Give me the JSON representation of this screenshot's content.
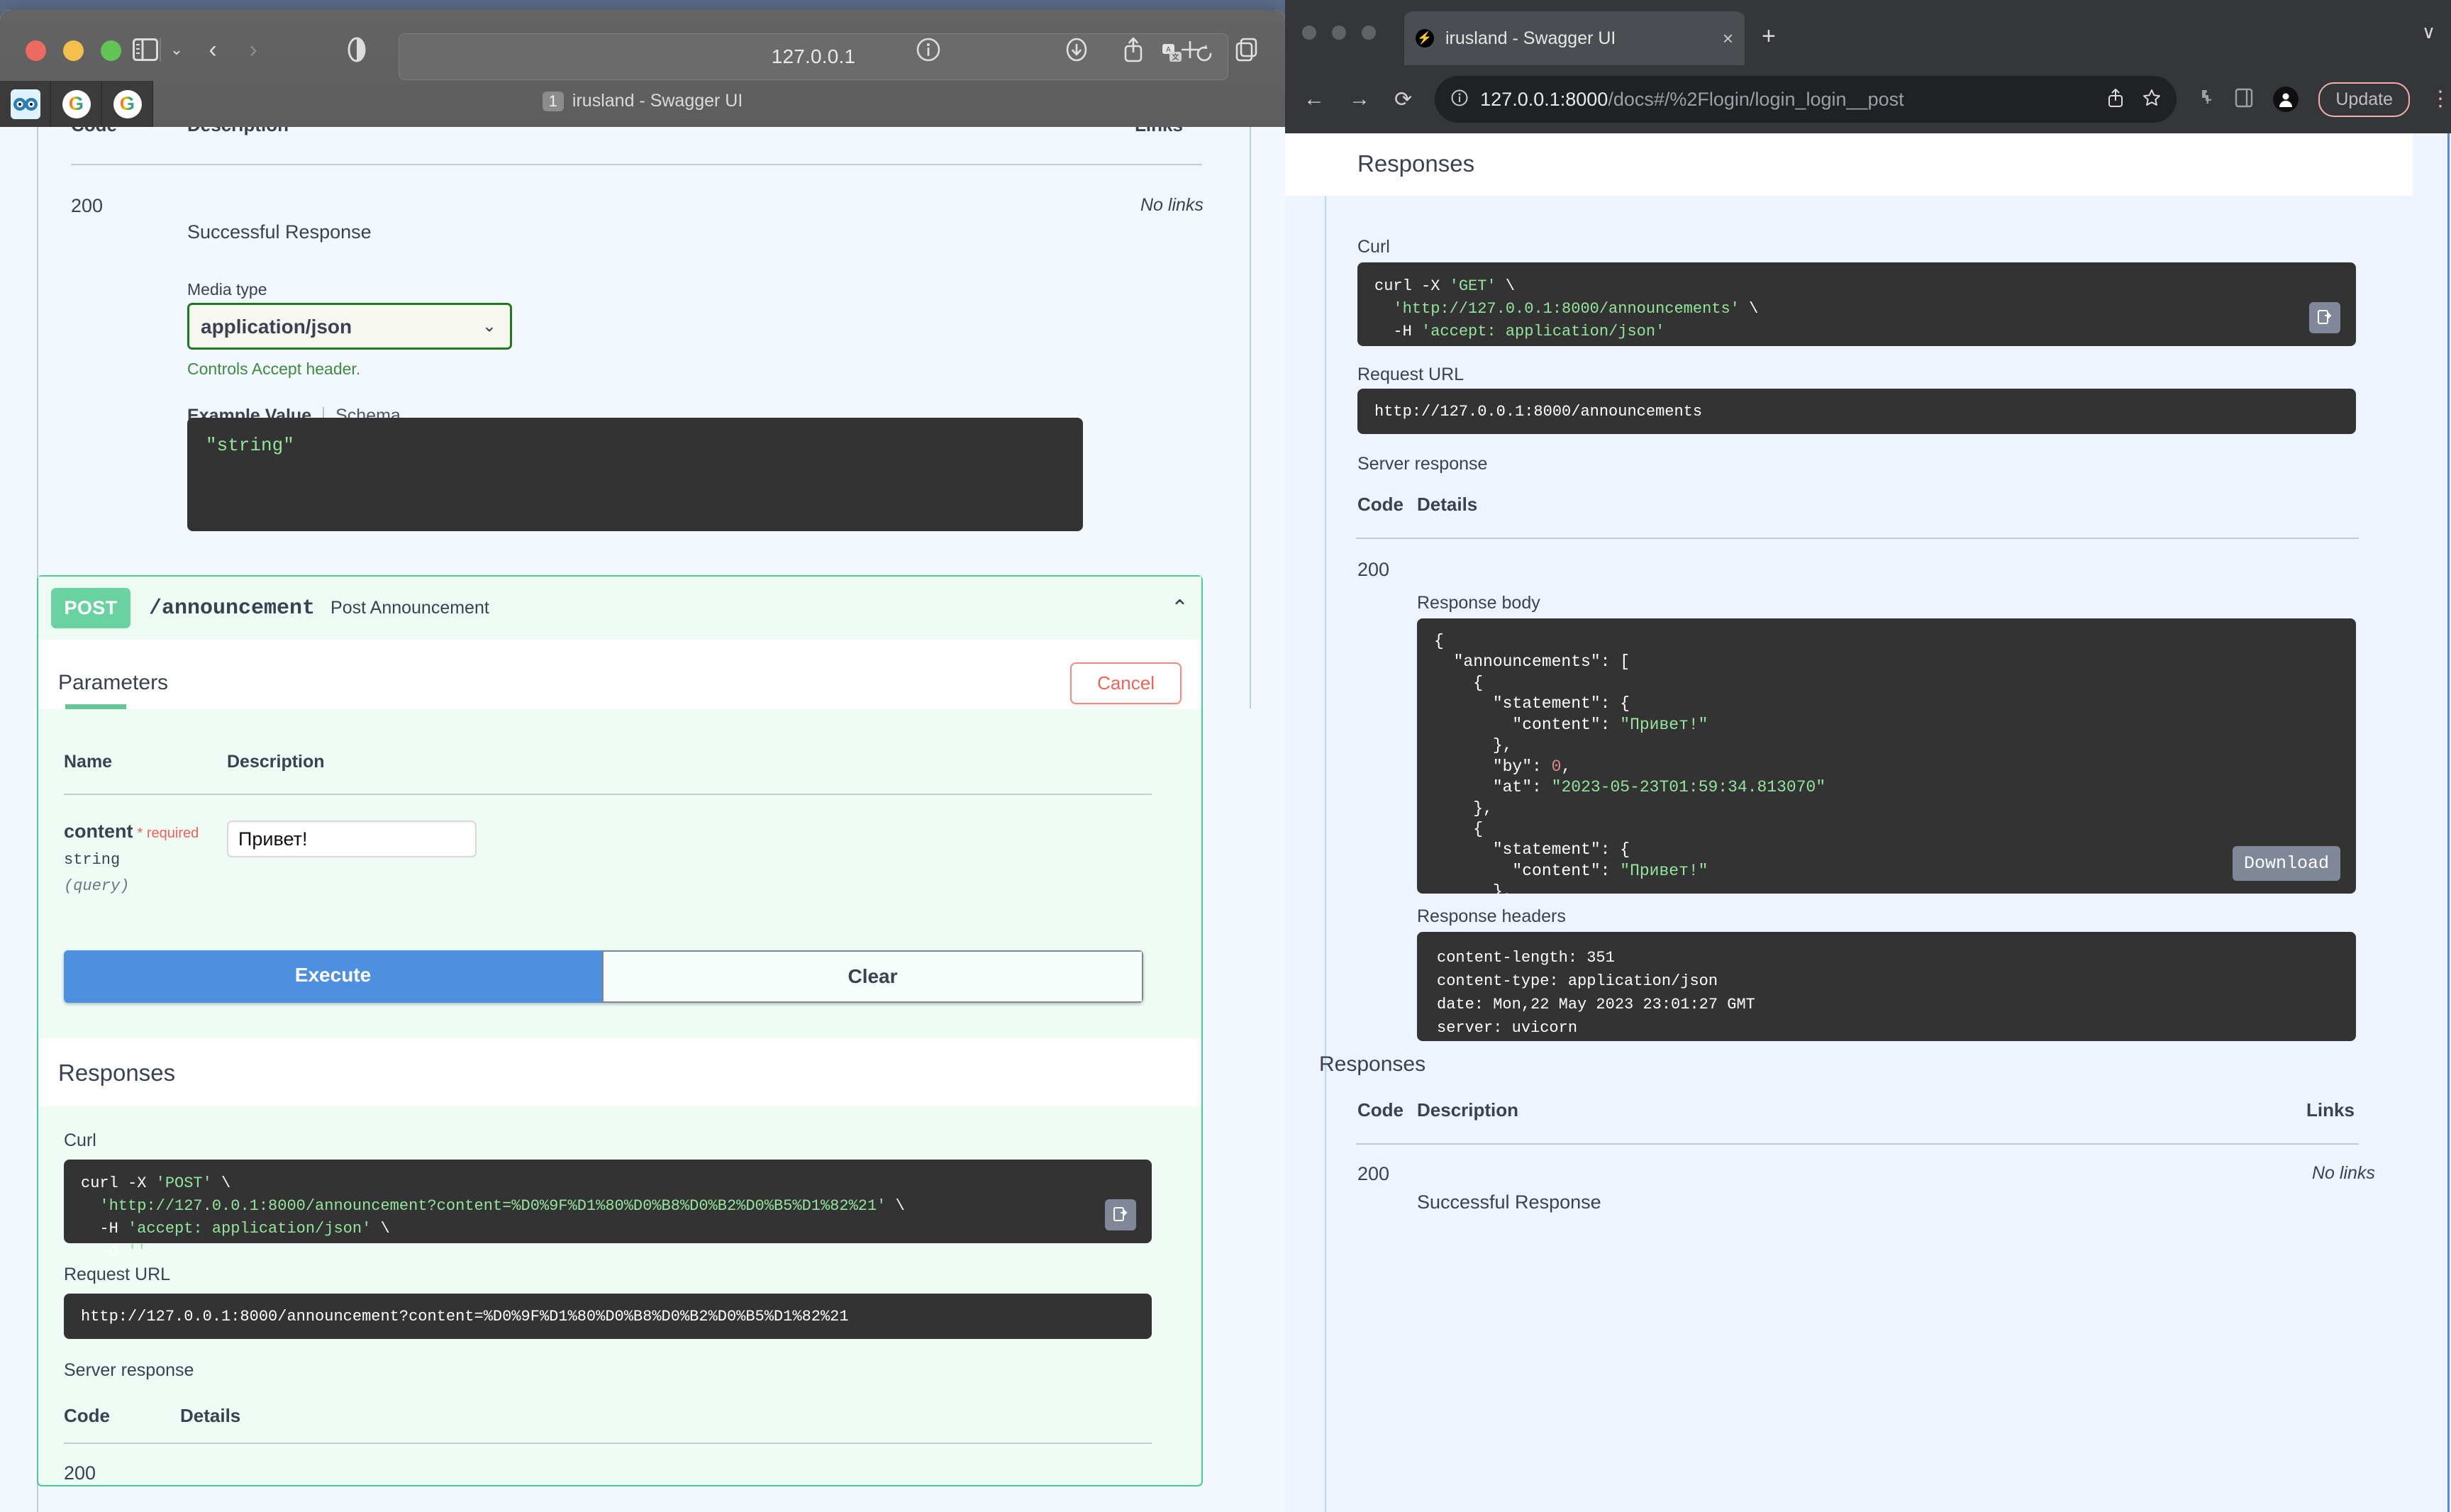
{
  "safari": {
    "window_title": "irusland - Swagger UI",
    "tab_badge": "1",
    "url": "127.0.0.1",
    "icons": {
      "sidebar": "sidebar-icon",
      "sidebar_chevron": "chevron-down-icon",
      "back": "chevron-left-icon",
      "forward": "chevron-right-icon",
      "shield": "reader-icon",
      "translate": "translate-icon",
      "reload": "reload-icon",
      "info": "info-icon",
      "downloads": "download-icon",
      "share": "share-icon",
      "newtab": "plus-icon",
      "taboverview": "tab-overview-icon"
    },
    "favorites": [
      "irusland-favicon",
      "google-favicon",
      "google-favicon"
    ]
  },
  "chrome": {
    "tab_title": "irusland - Swagger UI",
    "tab_close": "×",
    "new_tab": "+",
    "tabstrip_chevron": "∨",
    "url": "127.0.0.1:8000",
    "url_path": "/docs#/%2Flogin/login_login__post",
    "update_label": "Update",
    "icons": {
      "back": "arrow-left-icon",
      "forward": "arrow-right-icon",
      "reload": "reload-icon",
      "site-info": "info-circle-icon",
      "share": "share-icon",
      "bookmark": "star-icon",
      "extensions": "puzzle-icon",
      "sidepanel": "side-panel-icon",
      "profile": "profile-avatar-icon",
      "menu": "kebab-menu-icon"
    }
  },
  "swagger_left": {
    "responses_table": {
      "headers": [
        "Code",
        "Description",
        "Links"
      ],
      "rows": [
        {
          "code": "200",
          "description": "Successful Response",
          "links": "No links"
        }
      ]
    },
    "media_type_label": "Media type",
    "media_type_value": "application/json",
    "media_type_options": [
      "application/json"
    ],
    "controls_accept": "Controls Accept header.",
    "example_tabs": {
      "active": "Example Value",
      "inactive": "Schema"
    },
    "example_value_body": "\"string\"",
    "operation": {
      "verb": "POST",
      "path": "/announcement",
      "summary": "Post Announcement",
      "collapse_icon": "chevron-up-icon"
    },
    "parameters_title": "Parameters",
    "cancel_label": "Cancel",
    "param_headers": [
      "Name",
      "Description"
    ],
    "param": {
      "name": "content",
      "required_label": "* required",
      "type": "string",
      "in": "(query)",
      "value": "Привет!"
    },
    "execute_label": "Execute",
    "clear_label": "Clear",
    "responses_title": "Responses",
    "curl_label": "Curl",
    "curl_lines": [
      "curl -X 'POST' \\",
      "  'http://127.0.0.1:8000/announcement?content=%D0%9F%D1%80%D0%B8%D0%B2%D0%B5%D1%82%21' \\",
      "  -H 'accept: application/json' \\",
      "  -d ''"
    ],
    "request_url_label": "Request URL",
    "request_url": "http://127.0.0.1:8000/announcement?content=%D0%9F%D1%80%D0%B8%D0%B2%D0%B5%D1%82%21",
    "server_response_label": "Server response",
    "server_headers": [
      "Code",
      "Details"
    ],
    "server_code": "200"
  },
  "swagger_right": {
    "responses_title": "Responses",
    "curl_label": "Curl",
    "curl_lines": [
      "curl -X 'GET' \\",
      "  'http://127.0.0.1:8000/announcements' \\",
      "  -H 'accept: application/json'"
    ],
    "request_url_label": "Request URL",
    "request_url": "http://127.0.0.1:8000/announcements",
    "server_response_label": "Server response",
    "server_headers": [
      "Code",
      "Details"
    ],
    "server_code": "200",
    "response_body_label": "Response body",
    "response_body": "{\n  \"announcements\": [\n    {\n      \"statement\": {\n        \"content\": \"Привет!\"\n      },\n      \"by\": 0,\n      \"at\": \"2023-05-23T01:59:34.813070\"\n    },\n    {\n      \"statement\": {\n        \"content\": \"Привет!\"\n      },\n      \"by\": 0,\n      \"at\": \"2023-05-23T02:01:10.862164\"\n    },\n    {\n      \"statement\": {\n        \"content\": \"Привет!\"\n      },\n      \"by\": 0,\n      \"at\": \"2023-05-23T02:01:20.100805\"\n    },\n    {\n      \"statement\": {",
    "download_label": "Download",
    "response_headers_label": "Response headers",
    "response_headers": "content-length: 351\ncontent-type: application/json\ndate: Mon,22 May 2023 23:01:27 GMT\nserver: uvicorn",
    "responses_table": {
      "headers": [
        "Code",
        "Description",
        "Links"
      ],
      "rows": [
        {
          "code": "200",
          "description": "Successful Response",
          "links": "No links"
        }
      ]
    }
  },
  "colors": {
    "post_green": "#69d2a0",
    "execute_blue": "#4d90e0",
    "cancel_red": "#f0625a",
    "code_bg": "#333333",
    "page_bg": "#f3f8ff"
  }
}
